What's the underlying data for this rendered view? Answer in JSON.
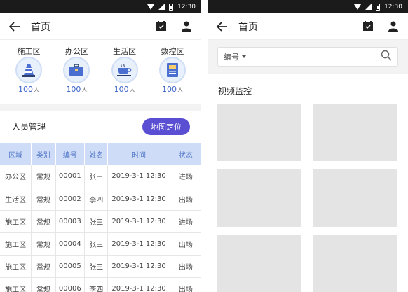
{
  "left": {
    "status": {
      "time": "12:30"
    },
    "appbar": {
      "title": "首页"
    },
    "zones": [
      {
        "label": "施工区",
        "count": "100",
        "unit": "人",
        "icon": "traffic-cone-icon"
      },
      {
        "label": "办公区",
        "count": "100",
        "unit": "人",
        "icon": "briefcase-icon"
      },
      {
        "label": "生活区",
        "count": "100",
        "unit": "人",
        "icon": "coffee-cup-icon"
      },
      {
        "label": "数控区",
        "count": "100",
        "unit": "人",
        "icon": "control-panel-icon"
      }
    ],
    "section_title": "人员管理",
    "map_button": "地图定位",
    "table": {
      "headers": [
        "区域",
        "类别",
        "编号",
        "姓名",
        "时间",
        "状态"
      ],
      "rows": [
        [
          "办公区",
          "常规",
          "00001",
          "张三",
          "2019-3-1 12:30",
          "进场"
        ],
        [
          "生活区",
          "常规",
          "00002",
          "李四",
          "2019-3-1 12:30",
          "出场"
        ],
        [
          "施工区",
          "常规",
          "00003",
          "张三",
          "2019-3-1 12:30",
          "进场"
        ],
        [
          "施工区",
          "常规",
          "00004",
          "张三",
          "2019-3-1 12:30",
          "出场"
        ],
        [
          "施工区",
          "常规",
          "00005",
          "张三",
          "2019-3-1 12:30",
          "出场"
        ],
        [
          "施工区",
          "常规",
          "00006",
          "李四",
          "2019-3-1 12:30",
          "出场"
        ]
      ]
    }
  },
  "right": {
    "status": {
      "time": "12:30"
    },
    "appbar": {
      "title": "首页"
    },
    "search": {
      "select_value": "编号"
    },
    "video_title": "视频监控",
    "tile_count_label": ""
  },
  "colors": {
    "accent": "#5a4ed2",
    "table_header_bg": "#cfdcf7",
    "count_blue": "#3a64c8",
    "highlight": "#f6cf6a"
  }
}
